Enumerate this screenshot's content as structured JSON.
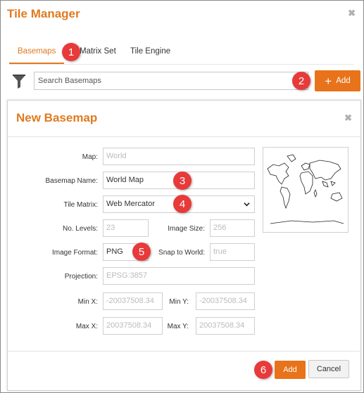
{
  "window": {
    "title": "Tile Manager",
    "close_glyph": "✖"
  },
  "tabs": [
    {
      "label": "Basemaps",
      "active": true
    },
    {
      "label": "Matrix Set",
      "active": false
    },
    {
      "label": "Tile Engine",
      "active": false
    }
  ],
  "search": {
    "placeholder": "Search Basemaps",
    "value": ""
  },
  "toolbar": {
    "add_label": "Add",
    "add_icon": "plus-icon",
    "filter_icon": "filter-icon"
  },
  "dialog": {
    "title": "New Basemap",
    "close_glyph": "✖",
    "fields": {
      "map": {
        "label": "Map:",
        "value": "World"
      },
      "basemap_name": {
        "label": "Basemap Name:",
        "value": "World Map"
      },
      "tile_matrix": {
        "label": "Tile Matrix:",
        "value": "Web Mercator"
      },
      "no_levels": {
        "label": "No. Levels:",
        "value": "23"
      },
      "image_size": {
        "label": "Image Size:",
        "value": "256"
      },
      "image_format": {
        "label": "Image Format:",
        "value": "PNG"
      },
      "snap_to_world": {
        "label": "Snap to World:",
        "value": "true"
      },
      "projection": {
        "label": "Projection:",
        "value": "EPSG:3857"
      },
      "min_x": {
        "label": "Min X:",
        "value": "-20037508.34"
      },
      "min_y": {
        "label": "Min Y:",
        "value": "-20037508.34"
      },
      "max_x": {
        "label": "Max X:",
        "value": "20037508.34"
      },
      "max_y": {
        "label": "Max Y:",
        "value": "20037508.34"
      }
    },
    "add_label": "Add",
    "cancel_label": "Cancel"
  },
  "callouts": [
    "1",
    "2",
    "3",
    "4",
    "5",
    "6"
  ],
  "colors": {
    "accent": "#e8731a",
    "title": "#e07a1f",
    "callout": "#e83a3a"
  }
}
